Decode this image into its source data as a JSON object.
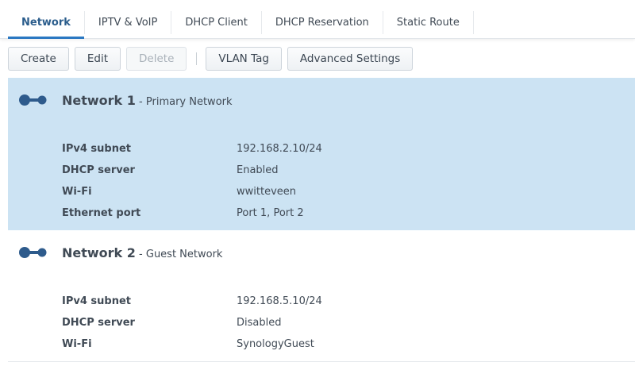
{
  "tabs": [
    {
      "label": "Network",
      "active": true
    },
    {
      "label": "IPTV & VoIP",
      "active": false
    },
    {
      "label": "DHCP Client",
      "active": false
    },
    {
      "label": "DHCP Reservation",
      "active": false
    },
    {
      "label": "Static Route",
      "active": false
    }
  ],
  "toolbar": {
    "create": "Create",
    "edit": "Edit",
    "delete": "Delete",
    "vlan": "VLAN Tag",
    "advanced": "Advanced Settings"
  },
  "networks": [
    {
      "name": "Network 1",
      "desc": "- Primary Network",
      "selected": true,
      "rows": [
        {
          "label": "IPv4 subnet",
          "value": "192.168.2.10/24"
        },
        {
          "label": "DHCP server",
          "value": "Enabled"
        },
        {
          "label": "Wi-Fi",
          "value": "wwitteveen"
        },
        {
          "label": "Ethernet port",
          "value": "Port 1, Port 2"
        }
      ]
    },
    {
      "name": "Network 2",
      "desc": "- Guest Network",
      "selected": false,
      "rows": [
        {
          "label": "IPv4 subnet",
          "value": "192.168.5.10/24"
        },
        {
          "label": "DHCP server",
          "value": "Disabled"
        },
        {
          "label": "Wi-Fi",
          "value": "SynologyGuest"
        }
      ]
    }
  ],
  "colors": {
    "accent": "#2b78c2",
    "selected_bg": "#cce3f3",
    "icon": "#2e5b8c"
  },
  "icons": {
    "network": "network-connection-icon"
  }
}
